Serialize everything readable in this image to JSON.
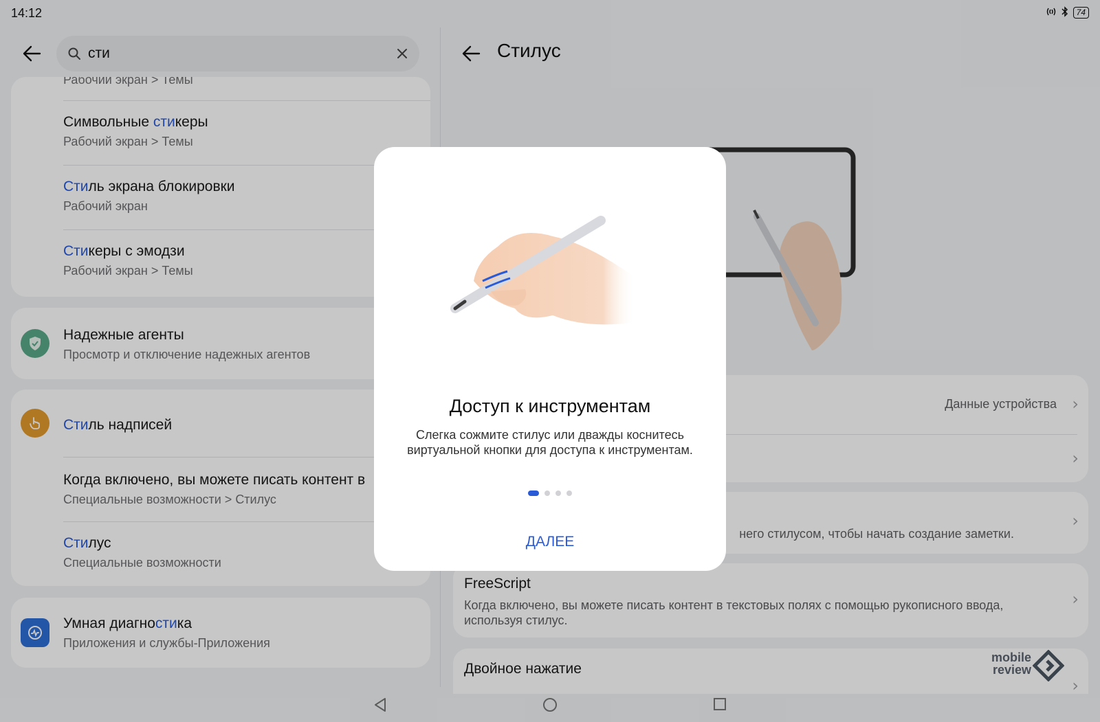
{
  "status_bar": {
    "time": "14:12",
    "battery": "74"
  },
  "search": {
    "value": "сти"
  },
  "left_list": {
    "partial_top_sub": "Рабочий экран > Темы",
    "card1": [
      {
        "title_hl": "",
        "title_pre": "Символьные ",
        "title_match": "сти",
        "title_post": "керы",
        "sub": "Рабочий экран > Темы"
      },
      {
        "title_pre": "",
        "title_match": "Сти",
        "title_post": "ль экрана блокировки",
        "sub": "Рабочий экран"
      },
      {
        "title_pre": "",
        "title_match": "Сти",
        "title_post": "керы с эмодзи",
        "sub": "Рабочий экран > Темы"
      }
    ],
    "trusted_agents": {
      "title": "Надежные агенты",
      "sub": "Просмотр и отключение надежных агентов"
    },
    "card3": {
      "main": {
        "title_match": "Сти",
        "title_post": "ль надписей"
      },
      "items": [
        {
          "title": "Когда включено, вы можете писать контент в",
          "sub": "Специальные возможности > Стилус"
        },
        {
          "title_match": "Сти",
          "title_post": "лус",
          "sub": "Специальные возможности"
        }
      ]
    },
    "smart_diag": {
      "title_pre": "Умная диагно",
      "title_match": "сти",
      "title_post": "ка",
      "sub": "Приложения и службы-Приложения"
    }
  },
  "right_pane": {
    "title": "Стилус",
    "device_data_label": "Данные устройства",
    "note_partial": "него стилусом, чтобы начать создание заметки.",
    "freescript": {
      "title": "FreeScript",
      "sub": "Когда включено, вы можете писать контент в текстовых полях с помощью рукописного ввода, используя стилус."
    },
    "double_tap": {
      "title": "Двойное нажатие"
    }
  },
  "dialog": {
    "title": "Доступ к инструментам",
    "text": "Слегка сожмите стилус или дважды коснитесь виртуальной кнопки для доступа к инструментам.",
    "page_index": 1,
    "page_count": 4,
    "next_label": "ДАЛЕЕ"
  },
  "watermark": {
    "line1": "mobile",
    "line2": "review"
  },
  "colors": {
    "accent": "#2a5bd7",
    "trusted_icon": "#5aa88a",
    "style_icon": "#e39a2d",
    "diag_icon": "#2f6fd6"
  }
}
